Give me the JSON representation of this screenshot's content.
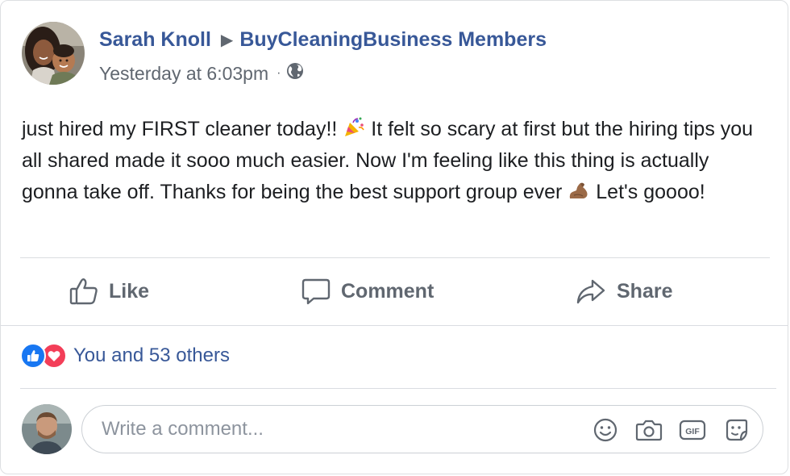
{
  "post": {
    "author": "Sarah Knoll",
    "group": "BuyCleaningBusiness Members",
    "timestamp": "Yesterday at 6:03pm",
    "audience_icon": "globe-icon",
    "text_part1": "just hired my FIRST cleaner today!! ",
    "text_part2": " It felt so scary at first but the hiring tips you all shared made it sooo much easier. Now I'm feeling like this thing is actually gonna take off. Thanks for being the best support group ever ",
    "text_part3": " Let's goooo!",
    "emojis": [
      "party-popper-emoji",
      "flexed-biceps-emoji"
    ]
  },
  "actions": {
    "like": "Like",
    "comment": "Comment",
    "share": "Share"
  },
  "reactions": {
    "icons": [
      "like-reaction-icon",
      "love-reaction-icon"
    ],
    "summary": "You and 53 others"
  },
  "comment_box": {
    "placeholder": "Write a comment...",
    "icons": [
      "emoji-icon",
      "camera-icon",
      "gif-icon",
      "sticker-icon"
    ]
  },
  "colors": {
    "link": "#385898",
    "secondary_text": "#606770",
    "like_blue": "#1877f2",
    "love_red": "#f33e58"
  }
}
